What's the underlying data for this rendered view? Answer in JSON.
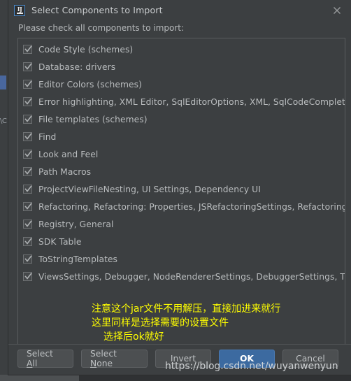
{
  "window": {
    "icon_name": "intellij-idea-icon",
    "icon_text": "IJ",
    "title": "Select Components to Import",
    "close_label": "×"
  },
  "dialog": {
    "subtitle": "Please check all components to import:"
  },
  "components": [
    {
      "label": "Code Style (schemes)",
      "checked": true
    },
    {
      "label": "Database: drivers",
      "checked": true
    },
    {
      "label": "Editor Colors (schemes)",
      "checked": true
    },
    {
      "label": "Error highlighting, XML Editor, SqlEditorOptions, XML, SqlCodeCompletion",
      "checked": true
    },
    {
      "label": "File templates (schemes)",
      "checked": true
    },
    {
      "label": "Find",
      "checked": true
    },
    {
      "label": "Look and Feel",
      "checked": true
    },
    {
      "label": "Path Macros",
      "checked": true
    },
    {
      "label": "ProjectViewFileNesting, UI Settings, Dependency UI",
      "checked": true
    },
    {
      "label": "Refactoring, Refactoring: Properties, JSRefactoringSettings, RefactoringSett",
      "checked": true
    },
    {
      "label": "Registry, General",
      "checked": true
    },
    {
      "label": "SDK Table",
      "checked": true
    },
    {
      "label": "ToStringTemplates",
      "checked": true
    },
    {
      "label": "ViewsSettings, Debugger, NodeRendererSettings, DebuggerSettings, Threa",
      "checked": true
    }
  ],
  "buttons": {
    "select_all": "Select All",
    "select_all_mnemonic": "A",
    "select_none": "Select None",
    "select_none_mnemonic": "N",
    "invert": "Invert",
    "ok": "OK",
    "cancel": "Cancel"
  },
  "annotation": {
    "color": "#ffff00",
    "line1": "注意这个jar文件不用解压，直接加进来就行",
    "line2": "这里同样是选择需要的设置文件",
    "line3": "选择后ok就好"
  },
  "watermark": {
    "text": "https://blog.csdn.net/wuyanwenyun"
  },
  "background_window": {
    "fragment_text": "\\C"
  },
  "theme": {
    "dialog_bg": "#3c3f41",
    "text": "#b9bcbe",
    "accent_ok": "#3c6aa0",
    "annotation": "#ffff00"
  }
}
